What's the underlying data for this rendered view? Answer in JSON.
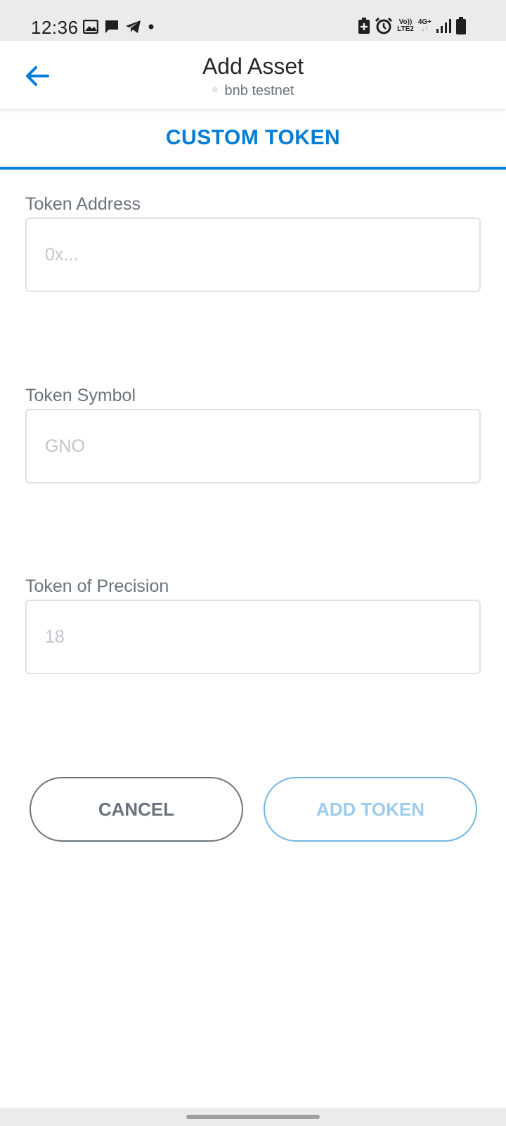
{
  "status_bar": {
    "time": "12:36",
    "left_icons": [
      "image-icon",
      "message-icon",
      "telegram-icon",
      "dot-icon"
    ],
    "volte_top": "Vo))",
    "volte_bottom": "LTE2",
    "network_type": "4G+",
    "right_icons": [
      "battery-saver-icon",
      "alarm-icon",
      "signal-icon",
      "battery-icon"
    ]
  },
  "header": {
    "back_icon": "arrow-left-icon",
    "title": "Add Asset",
    "network": "bnb testnet"
  },
  "tab": {
    "label": "CUSTOM TOKEN"
  },
  "form": {
    "address": {
      "label": "Token Address",
      "placeholder": "0x...",
      "value": ""
    },
    "symbol": {
      "label": "Token Symbol",
      "placeholder": "GNO",
      "value": ""
    },
    "precision": {
      "label": "Token of Precision",
      "placeholder": "18",
      "value": ""
    }
  },
  "actions": {
    "cancel_label": "CANCEL",
    "add_label": "ADD TOKEN"
  },
  "colors": {
    "accent": "#037dd6",
    "text_muted": "#6a737d",
    "disabled_blue": "#9ccbeb"
  }
}
